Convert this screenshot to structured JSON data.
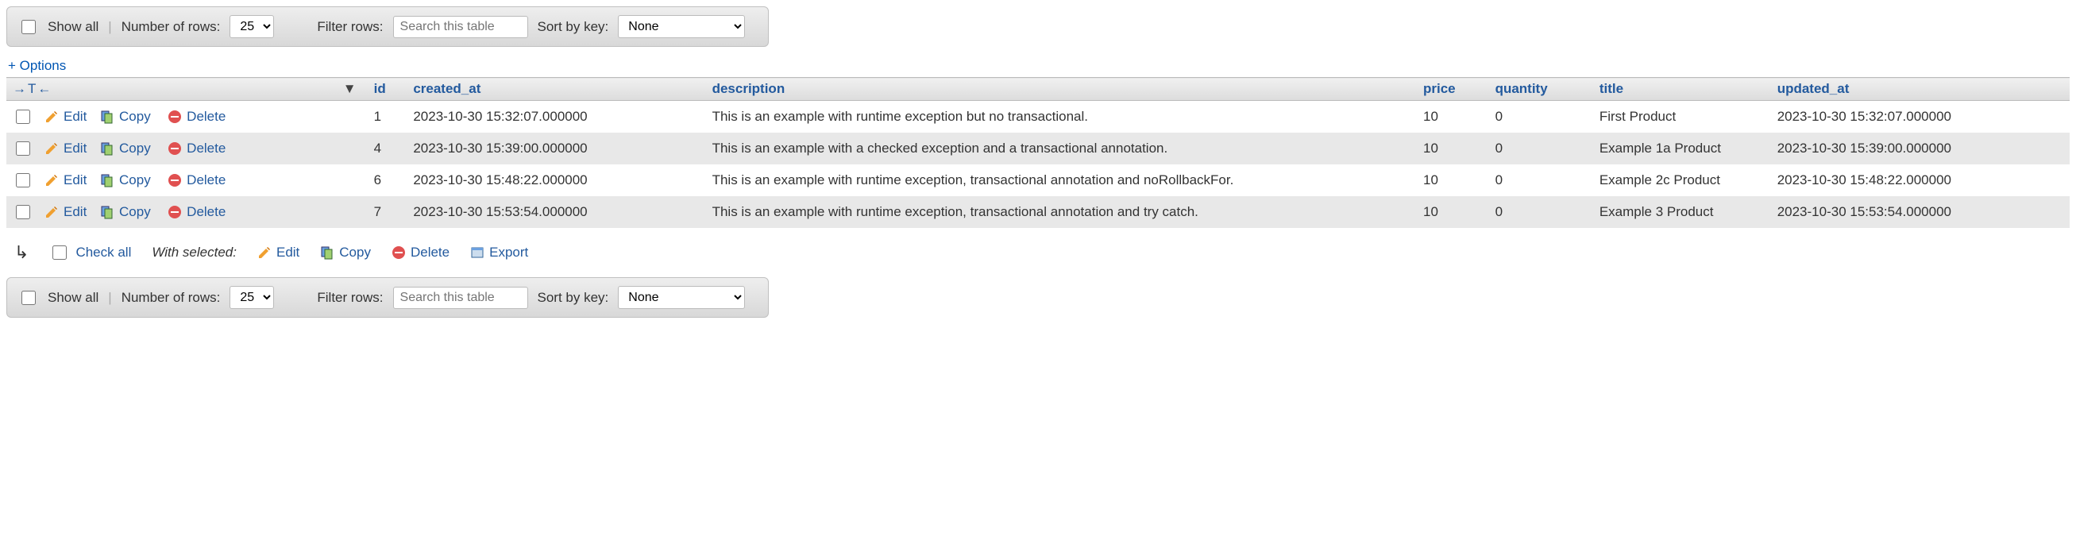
{
  "toolbar": {
    "show_all": "Show all",
    "num_rows_label": "Number of rows:",
    "num_rows_value": "25",
    "filter_label": "Filter rows:",
    "filter_placeholder": "Search this table",
    "sort_label": "Sort by key:",
    "sort_value": "None"
  },
  "options_link": "+ Options",
  "columns": {
    "id": "id",
    "created_at": "created_at",
    "description": "description",
    "price": "price",
    "quantity": "quantity",
    "title": "title",
    "updated_at": "updated_at"
  },
  "row_actions": {
    "edit": "Edit",
    "copy": "Copy",
    "delete": "Delete"
  },
  "rows": [
    {
      "id": "1",
      "created_at": "2023-10-30 15:32:07.000000",
      "description": "This is an example with runtime exception but no transactional.",
      "price": "10",
      "quantity": "0",
      "title": "First Product",
      "updated_at": "2023-10-30 15:32:07.000000"
    },
    {
      "id": "4",
      "created_at": "2023-10-30 15:39:00.000000",
      "description": "This is an example with a checked exception and a transactional annotation.",
      "price": "10",
      "quantity": "0",
      "title": "Example 1a Product",
      "updated_at": "2023-10-30 15:39:00.000000"
    },
    {
      "id": "6",
      "created_at": "2023-10-30 15:48:22.000000",
      "description": "This is an example with runtime exception, transactional annotation and noRollbackFor.",
      "price": "10",
      "quantity": "0",
      "title": "Example 2c Product",
      "updated_at": "2023-10-30 15:48:22.000000"
    },
    {
      "id": "7",
      "created_at": "2023-10-30 15:53:54.000000",
      "description": "This is an example with runtime exception, transactional annotation and try catch.",
      "price": "10",
      "quantity": "0",
      "title": "Example 3 Product",
      "updated_at": "2023-10-30 15:53:54.000000"
    }
  ],
  "below": {
    "check_all": "Check all",
    "with_selected": "With selected:",
    "edit": "Edit",
    "copy": "Copy",
    "delete": "Delete",
    "export": "Export"
  }
}
